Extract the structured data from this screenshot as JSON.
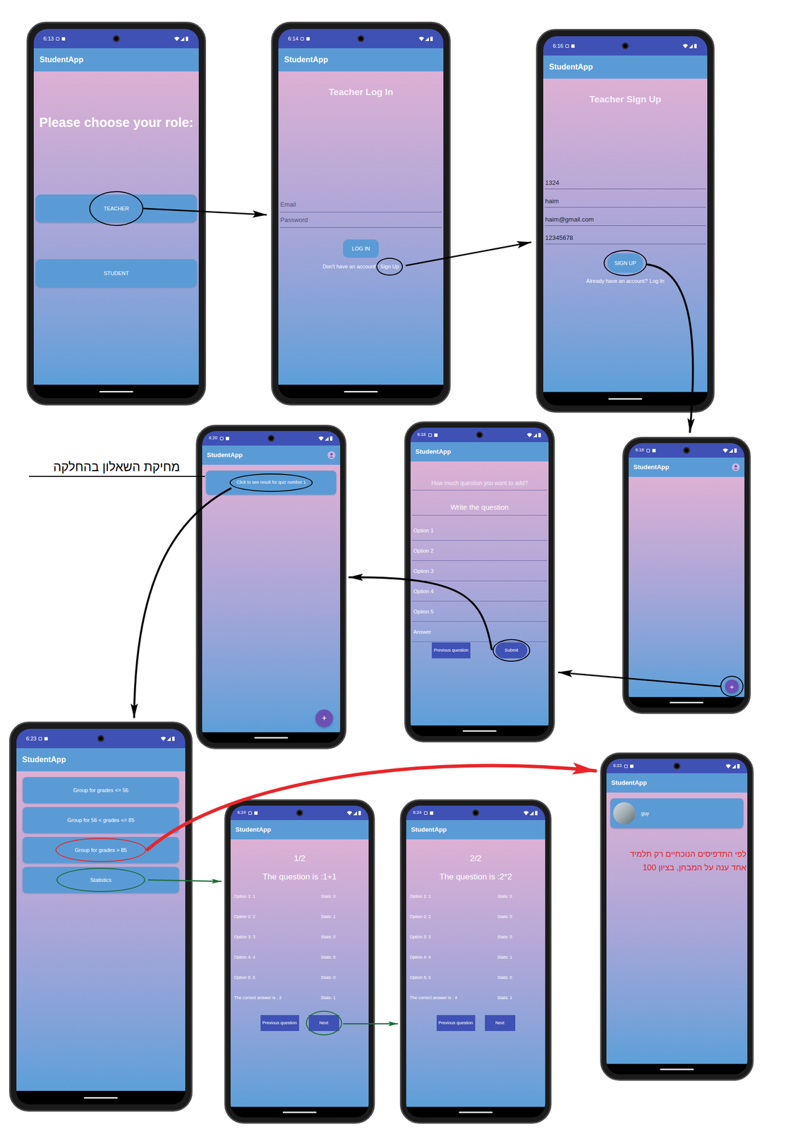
{
  "diagram": {
    "annotations": [
      {
        "text": "מחיקת השאלון בהחלקה"
      }
    ],
    "phones": [
      {
        "kind": "role",
        "time": "6:13",
        "app_title": "StudentApp",
        "heading": "Please choose your role:",
        "buttons": [
          {
            "label": "TEACHER",
            "circle": "#000000"
          },
          {
            "label": "STUDENT"
          }
        ]
      },
      {
        "kind": "login",
        "time": "6:14",
        "app_title": "StudentApp",
        "heading": "Teacher Log In",
        "fields": [
          {
            "placeholder": "Email"
          },
          {
            "placeholder": "Password"
          }
        ],
        "button": {
          "label": "LOG IN"
        },
        "link": {
          "prefix": "Don't have an account?",
          "action": "Sign Up",
          "circle": "#000000"
        }
      },
      {
        "kind": "signup",
        "time": "6:16",
        "app_title": "StudentApp",
        "heading": "Teacher Sign Up",
        "fields": [
          {
            "value": "1324"
          },
          {
            "value": "haim"
          },
          {
            "value": "haim@gmail.com"
          },
          {
            "value": "12345678"
          }
        ],
        "button": {
          "label": "SIGN UP",
          "circle": "#000000"
        },
        "link": {
          "prefix": "Already have an account?",
          "action": "Log In"
        }
      },
      {
        "kind": "empty-list",
        "time": "6:18",
        "app_title": "StudentApp",
        "fab": {
          "label": "+",
          "circle": "#000000"
        }
      },
      {
        "kind": "question-form",
        "time": "6:18",
        "app_title": "StudentApp",
        "count_placeholder": "How much question you want to add?",
        "question_placeholder": "Write the question",
        "option_placeholders": [
          "Option 1",
          "Option 2",
          "Option 3",
          "Option 4",
          "Option 5"
        ],
        "answer_placeholder": "Answer",
        "buttons": [
          {
            "label": "Previous question"
          },
          {
            "label": "Submit",
            "circle": "#000000"
          }
        ]
      },
      {
        "kind": "quiz-list",
        "time": "6:20",
        "app_title": "StudentApp",
        "items": [
          {
            "label": "Click to see result for quiz number 1",
            "circle": "#000000"
          }
        ],
        "fab": {
          "label": "+"
        }
      },
      {
        "kind": "groups",
        "time": "6:23",
        "app_title": "StudentApp",
        "items": [
          {
            "label": "Group for grades <= 56"
          },
          {
            "label": "Group for 56 < grades <= 85"
          },
          {
            "label": "Group for grades > 85",
            "circle": "#e8262a"
          },
          {
            "label": "Statistics",
            "circle": "#1e6b3c"
          }
        ]
      },
      {
        "kind": "stats",
        "time": "6:24",
        "app_title": "StudentApp",
        "page": "1/2",
        "question": "The question is :1+1",
        "rows": [
          {
            "label": "Option 1: 1",
            "stat": "Stats: 0"
          },
          {
            "label": "Option 2: 2",
            "stat": "Stats: 1"
          },
          {
            "label": "Option 3: 3",
            "stat": "Stats: 0"
          },
          {
            "label": "Option 4: 4",
            "stat": "Stats: 0"
          },
          {
            "label": "Option 5: 5",
            "stat": "Stats: 0"
          },
          {
            "label": "The correct answer is : 2",
            "stat": "Stats: 1"
          }
        ],
        "buttons": [
          {
            "label": "Previous question"
          },
          {
            "label": "Next",
            "circle": "#1e6b3c"
          }
        ]
      },
      {
        "kind": "stats",
        "time": "6:24",
        "app_title": "StudentApp",
        "page": "2/2",
        "question": "The question is :2*2",
        "rows": [
          {
            "label": "Option 1: 1",
            "stat": "Stats: 0"
          },
          {
            "label": "Option 2: 2",
            "stat": "Stats: 0"
          },
          {
            "label": "Option 3: 3",
            "stat": "Stats: 0"
          },
          {
            "label": "Option 4: 4",
            "stat": "Stats: 1"
          },
          {
            "label": "Option 5: 5",
            "stat": "Stats: 0"
          },
          {
            "label": "The correct answer is : 4",
            "stat": "Stats: 1"
          }
        ],
        "buttons": [
          {
            "label": "Previous question"
          },
          {
            "label": "Next"
          }
        ]
      },
      {
        "kind": "students",
        "time": "6:23",
        "app_title": "StudentApp",
        "students": [
          {
            "name": "guy"
          }
        ],
        "note": [
          "לפי התדפיסים הנוכחיים רק תלמיד",
          "אחד ענה על המבחן, בציון 100"
        ]
      }
    ],
    "arrows": [
      {
        "color": "#000000"
      },
      {
        "color": "#000000"
      },
      {
        "color": "#000000"
      },
      {
        "color": "#000000"
      },
      {
        "color": "#000000"
      },
      {
        "color": "#000000"
      },
      {
        "color": "#e8262a"
      },
      {
        "color": "#1e6b3c"
      },
      {
        "color": "#1e6b3c"
      }
    ]
  }
}
